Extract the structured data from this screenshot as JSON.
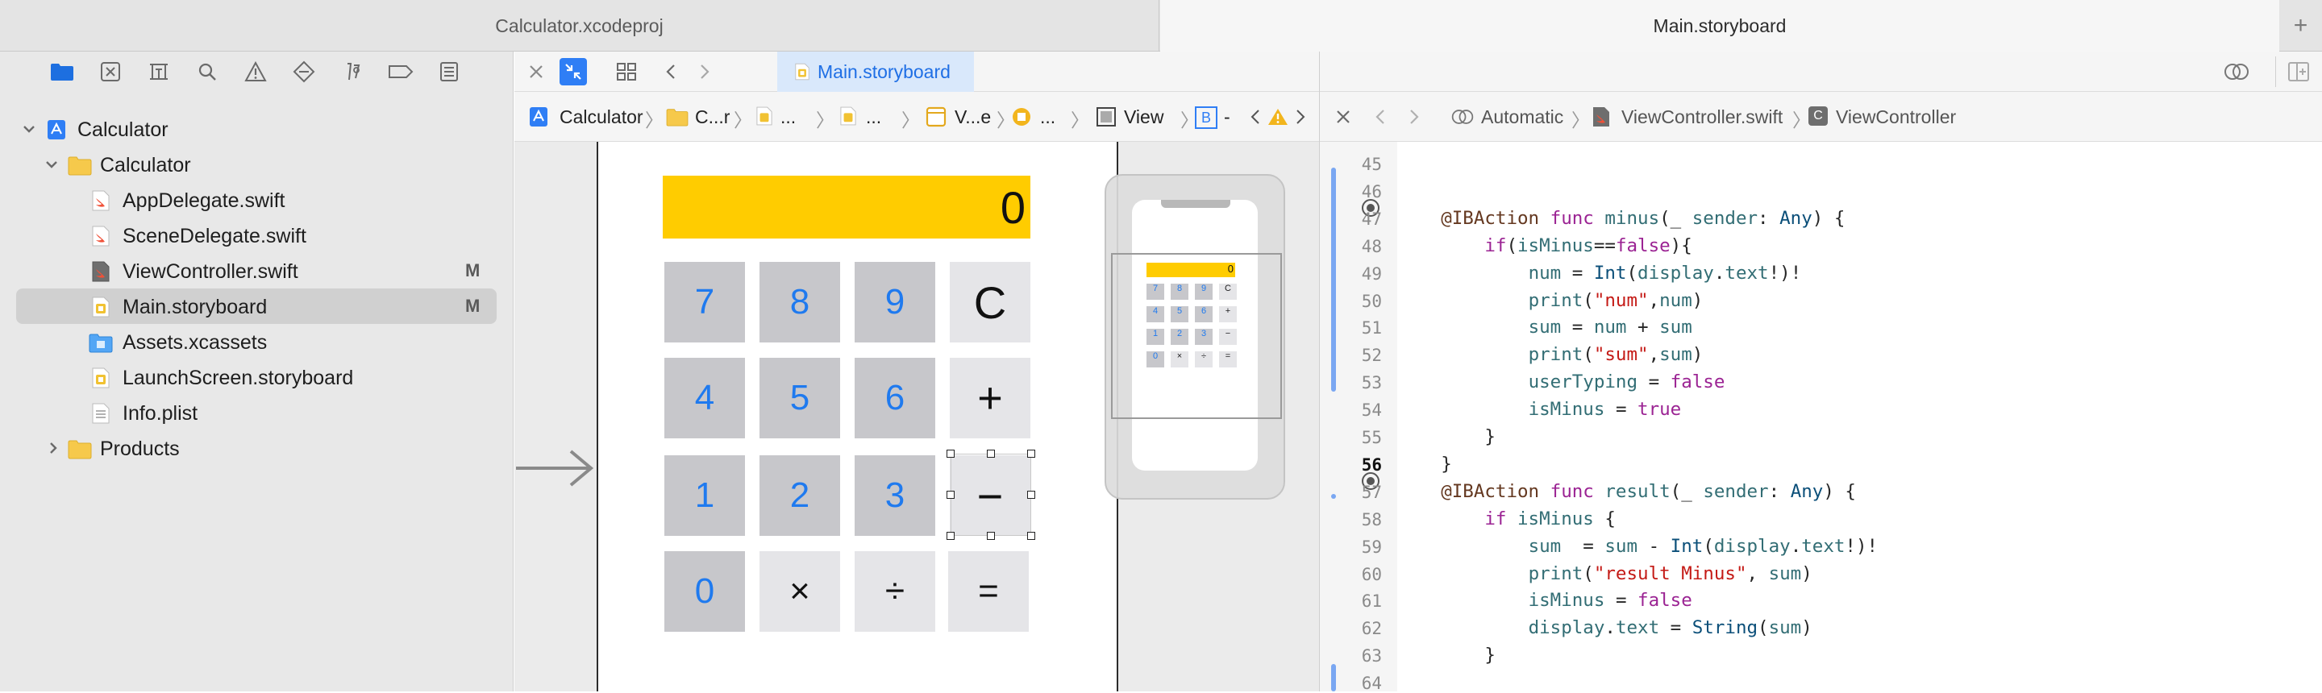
{
  "window_tabs": {
    "tab1": "Calculator.xcodeproj",
    "tab2": "Main.storyboard",
    "add": "+"
  },
  "navigator": {
    "items": [
      {
        "label": "Calculator",
        "icon": "project-icon",
        "badge": ""
      },
      {
        "label": "Calculator",
        "icon": "folder-icon",
        "badge": ""
      },
      {
        "label": "AppDelegate.swift",
        "icon": "swift-file-icon",
        "badge": ""
      },
      {
        "label": "SceneDelegate.swift",
        "icon": "swift-file-icon",
        "badge": ""
      },
      {
        "label": "ViewController.swift",
        "icon": "swift-file-icon",
        "badge": "M"
      },
      {
        "label": "Main.storyboard",
        "icon": "storyboard-icon",
        "badge": "M"
      },
      {
        "label": "Assets.xcassets",
        "icon": "asset-catalog-icon",
        "badge": ""
      },
      {
        "label": "LaunchScreen.storyboard",
        "icon": "storyboard-icon",
        "badge": ""
      },
      {
        "label": "Info.plist",
        "icon": "plist-icon",
        "badge": ""
      },
      {
        "label": "Products",
        "icon": "folder-icon",
        "badge": ""
      }
    ]
  },
  "editor": {
    "tab_label": "Main.storyboard",
    "jump_bar": [
      "Calculator",
      "C...r",
      "...",
      "...",
      "V...e",
      "...",
      "View",
      "-"
    ],
    "jump_bar_b": "B"
  },
  "calculator": {
    "display": "0",
    "buttons": [
      "7",
      "8",
      "9",
      "C",
      "4",
      "5",
      "6",
      "+",
      "1",
      "2",
      "3",
      "−",
      "0",
      "×",
      "÷",
      "="
    ],
    "display_color": "#ffcc00"
  },
  "code_editor": {
    "mode": "Automatic",
    "file": "ViewController.swift",
    "symbol": "ViewController",
    "lines": [
      {
        "num": "45",
        "text": ""
      },
      {
        "num": "46",
        "text": ""
      },
      {
        "num": "47",
        "text": "    @IBAction func minus(_ sender: Any) {"
      },
      {
        "num": "48",
        "text": "        if(isMinus==false){"
      },
      {
        "num": "49",
        "text": "            num = Int(display.text!)!"
      },
      {
        "num": "50",
        "text": "            print(\"num\",num)"
      },
      {
        "num": "51",
        "text": "            sum = num + sum"
      },
      {
        "num": "52",
        "text": "            print(\"sum\",sum)"
      },
      {
        "num": "53",
        "text": "            userTyping = false"
      },
      {
        "num": "54",
        "text": "            isMinus = true"
      },
      {
        "num": "55",
        "text": "        }"
      },
      {
        "num": "56",
        "text": "    }"
      },
      {
        "num": "57",
        "text": "    @IBAction func result(_ sender: Any) {"
      },
      {
        "num": "58",
        "text": "        if isMinus {"
      },
      {
        "num": "59",
        "text": "            sum  = sum - Int(display.text!)!"
      },
      {
        "num": "60",
        "text": "            print(\"result Minus\", sum)"
      },
      {
        "num": "61",
        "text": "            isMinus = false"
      },
      {
        "num": "62",
        "text": "            display.text = String(sum)"
      },
      {
        "num": "63",
        "text": "        }"
      },
      {
        "num": "64",
        "text": ""
      }
    ]
  }
}
